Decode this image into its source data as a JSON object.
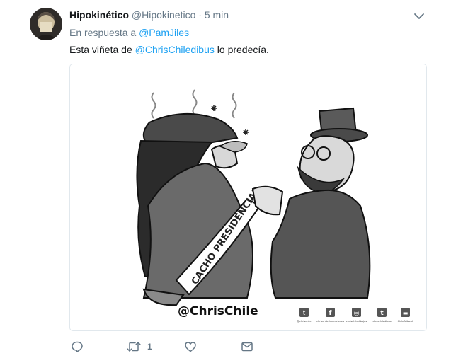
{
  "tweet": {
    "display_name": "Hipokinético",
    "handle": "@Hipokinetico",
    "separator": "·",
    "time": "5 min",
    "reply_prefix": "En respuesta a",
    "reply_to": "@PamJiles",
    "text_before": "Esta viñeta de",
    "text_mention": "@ChrisChiledibus",
    "text_after": "lo predecía."
  },
  "cartoon": {
    "sash_text": "CACHO PRESIDENCIAL",
    "signature": "@ChrisChile",
    "social": [
      {
        "icon": "twitter-icon",
        "glyph": "t",
        "label": "@chrischile"
      },
      {
        "icon": "facebook-icon",
        "glyph": "f",
        "label": "chrischileilustraciones"
      },
      {
        "icon": "instagram-icon",
        "glyph": "◎",
        "label": "chrischiledibujos"
      },
      {
        "icon": "tumblr-icon",
        "glyph": "t",
        "label": "chrischiledibus"
      },
      {
        "icon": "blog-icon",
        "glyph": "▬",
        "label": "ChileAtiba.cl"
      }
    ]
  },
  "actions": {
    "reply_count": "",
    "retweet_count": "1",
    "like_count": "",
    "icons": [
      "reply-icon",
      "retweet-icon",
      "like-icon",
      "direct-message-icon"
    ]
  },
  "colors": {
    "link": "#1da1f2",
    "muted": "#657786",
    "text": "#14171a",
    "border": "#e1e8ed"
  }
}
